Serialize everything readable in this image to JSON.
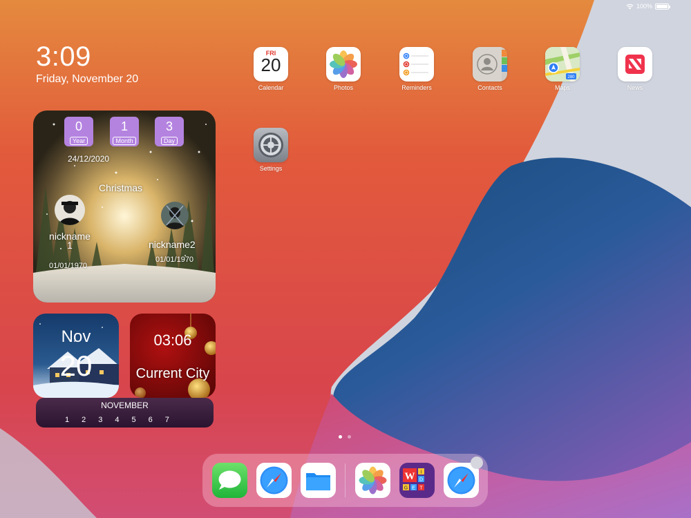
{
  "status_bar": {
    "battery_percent": "100%",
    "battery_level": 1.0,
    "wifi_icon": "wifi-icon",
    "battery_icon": "battery-icon"
  },
  "lock": {
    "time": "3:09",
    "date": "Friday, November 20"
  },
  "apps": [
    {
      "id": "calendar",
      "label": "Calendar",
      "icon": "calendar-icon",
      "day_name": "FRI",
      "day_num": "20"
    },
    {
      "id": "photos",
      "label": "Photos",
      "icon": "photos-icon"
    },
    {
      "id": "reminders",
      "label": "Reminders",
      "icon": "reminders-icon"
    },
    {
      "id": "contacts",
      "label": "Contacts",
      "icon": "contacts-icon"
    },
    {
      "id": "maps",
      "label": "Maps",
      "icon": "maps-icon",
      "route_sign": "280"
    },
    {
      "id": "news",
      "label": "News",
      "icon": "news-icon"
    },
    {
      "id": "settings",
      "label": "Settings",
      "icon": "settings-icon"
    }
  ],
  "christmas_widget": {
    "counters": [
      {
        "value": "0",
        "unit": "Year"
      },
      {
        "value": "1",
        "unit": "Month"
      },
      {
        "value": "3",
        "unit": "Day"
      }
    ],
    "target_date": "24/12/2020",
    "event": "Christmas",
    "person1": {
      "nickname": "nickname\n1",
      "date": "01/01/1970"
    },
    "person2": {
      "nickname": "nickname2",
      "date": "01/01/1970"
    }
  },
  "date_widget": {
    "month": "Nov",
    "day": "20"
  },
  "time_widget": {
    "time": "03:06",
    "city": "Current City"
  },
  "calendar_strip": {
    "month": "NOVEMBER",
    "days": [
      "1",
      "2",
      "3",
      "4",
      "5",
      "6",
      "7"
    ]
  },
  "page_dots": {
    "count": 2,
    "current": 1
  },
  "dock": [
    {
      "id": "messages",
      "icon": "messages-icon"
    },
    {
      "id": "safari",
      "icon": "safari-icon"
    },
    {
      "id": "files",
      "icon": "files-icon"
    },
    {
      "id": "photos",
      "icon": "photos-icon"
    },
    {
      "id": "widget-app",
      "icon": "widget-app-icon",
      "letters": [
        "W",
        "I",
        "D",
        "G",
        "E",
        "T"
      ]
    },
    {
      "id": "safari-2",
      "icon": "safari-icon"
    }
  ],
  "colors": {
    "counter_bg": "#b483e0",
    "calendar_red": "#e0352b",
    "news_red": "#f0334d"
  }
}
